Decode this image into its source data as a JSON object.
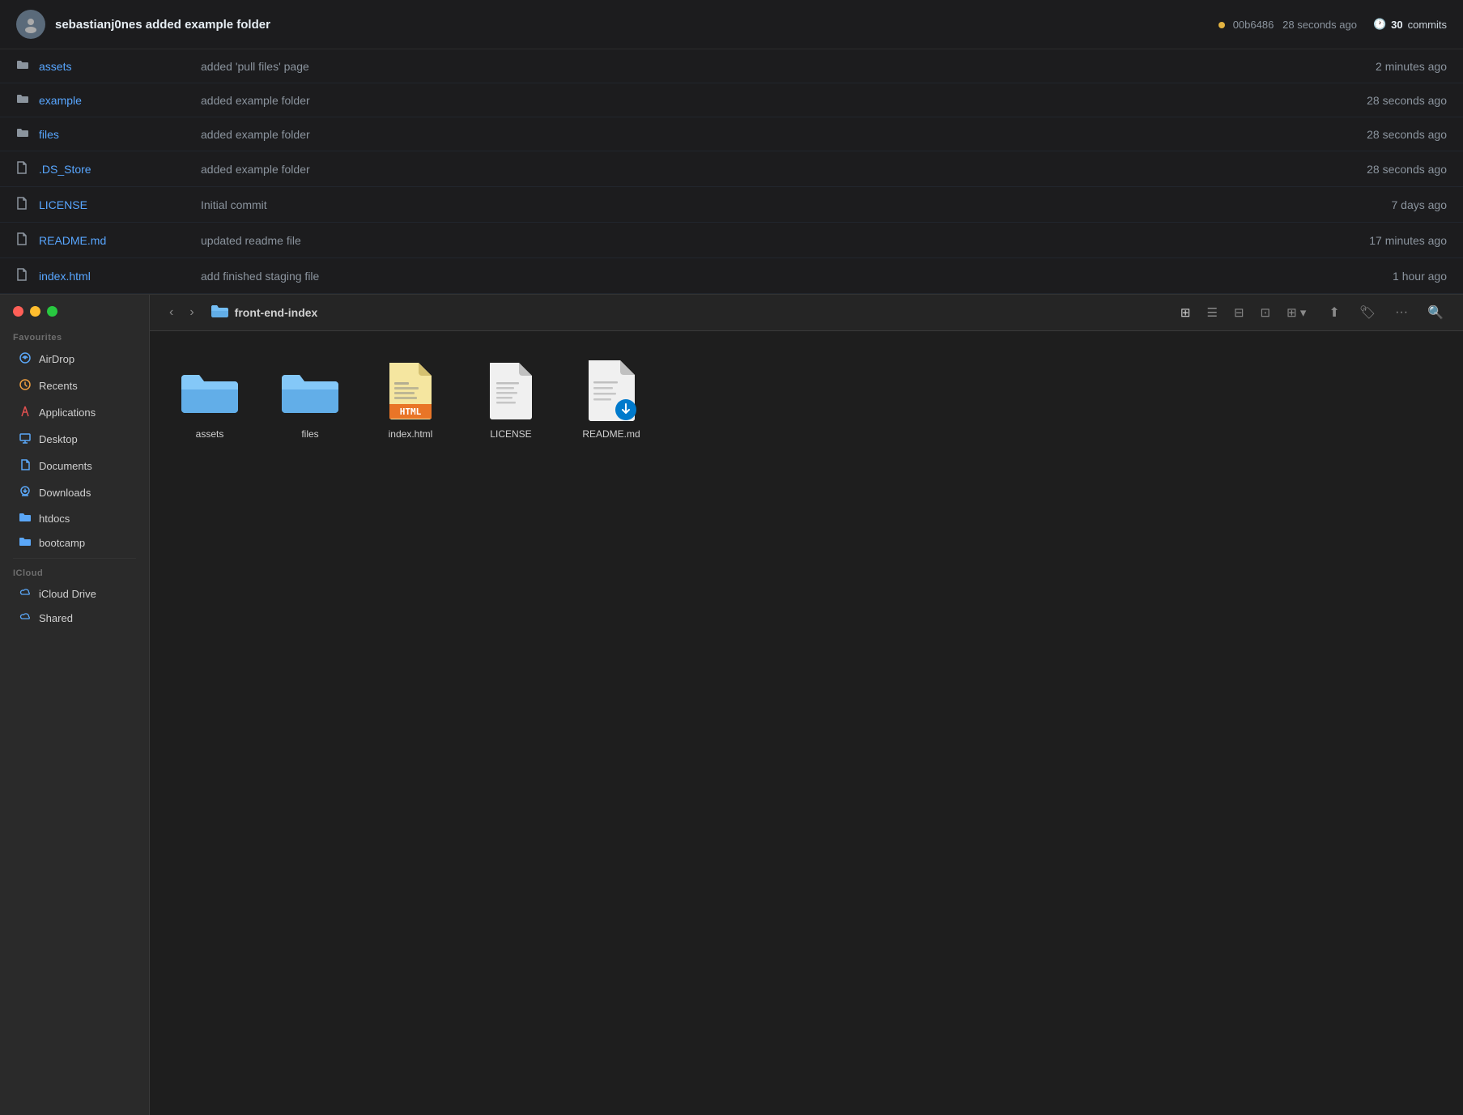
{
  "github": {
    "username": "sebastianj0nes",
    "commit_message": "sebastianj0nes added example folder",
    "commit_hash": "00b6486",
    "commit_time": "28 seconds ago",
    "commits_count": "30",
    "commits_label": "commits",
    "files": [
      {
        "name": "assets",
        "type": "folder",
        "commit": "added 'pull files' page",
        "time": "2 minutes ago"
      },
      {
        "name": "example",
        "type": "folder",
        "commit": "added example folder",
        "time": "28 seconds ago"
      },
      {
        "name": "files",
        "type": "folder",
        "commit": "added example folder",
        "time": "28 seconds ago"
      },
      {
        "name": ".DS_Store",
        "type": "file",
        "commit": "added example folder",
        "time": "28 seconds ago"
      },
      {
        "name": "LICENSE",
        "type": "file",
        "commit": "Initial commit",
        "time": "7 days ago"
      },
      {
        "name": "README.md",
        "type": "file",
        "commit": "updated readme file",
        "time": "17 minutes ago"
      },
      {
        "name": "index.html",
        "type": "file",
        "commit": "add finished staging file",
        "time": "1 hour ago"
      }
    ]
  },
  "finder": {
    "folder_name": "front-end-index",
    "sidebar": {
      "favourites_label": "Favourites",
      "icloud_label": "iCloud",
      "items_favourites": [
        {
          "label": "AirDrop",
          "icon": "airdrop"
        },
        {
          "label": "Recents",
          "icon": "recents"
        },
        {
          "label": "Applications",
          "icon": "applications"
        },
        {
          "label": "Desktop",
          "icon": "desktop"
        },
        {
          "label": "Documents",
          "icon": "documents"
        },
        {
          "label": "Downloads",
          "icon": "downloads"
        },
        {
          "label": "htdocs",
          "icon": "folder"
        },
        {
          "label": "bootcamp",
          "icon": "folder"
        }
      ],
      "items_icloud": [
        {
          "label": "iCloud Drive",
          "icon": "icloud"
        },
        {
          "label": "Shared",
          "icon": "icloud"
        }
      ]
    },
    "files": [
      {
        "name": "assets",
        "type": "folder"
      },
      {
        "name": "files",
        "type": "folder"
      },
      {
        "name": "index.html",
        "type": "html"
      },
      {
        "name": "LICENSE",
        "type": "generic"
      },
      {
        "name": "README.md",
        "type": "readme"
      }
    ]
  },
  "toolbar": {
    "back_label": "‹",
    "forward_label": "›"
  }
}
